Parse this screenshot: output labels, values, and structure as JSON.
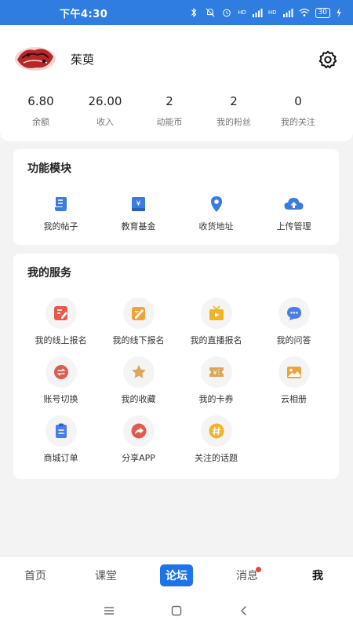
{
  "status_bar": {
    "time": "下午4:30",
    "network_labels": [
      "HD",
      "HD"
    ],
    "battery": "30"
  },
  "profile": {
    "username": "茱萸",
    "stats": [
      {
        "value": "6.80",
        "label": "余额"
      },
      {
        "value": "26.00",
        "label": "收入"
      },
      {
        "value": "2",
        "label": "动能币"
      },
      {
        "value": "2",
        "label": "我的粉丝"
      },
      {
        "value": "0",
        "label": "我的关注"
      }
    ]
  },
  "function_module": {
    "title": "功能模块",
    "items": [
      {
        "label": "我的帖子",
        "icon": "scroll-icon"
      },
      {
        "label": "教育基金",
        "icon": "book-yuan-icon"
      },
      {
        "label": "收货地址",
        "icon": "location-pin-icon"
      },
      {
        "label": "上传管理",
        "icon": "cloud-upload-icon"
      }
    ]
  },
  "my_services": {
    "title": "我的服务",
    "items": [
      {
        "label": "我的线上报名",
        "icon": "edit-doc-icon"
      },
      {
        "label": "我的线下报名",
        "icon": "pencil-pad-icon"
      },
      {
        "label": "我的直播报名",
        "icon": "tv-play-icon"
      },
      {
        "label": "我的问答",
        "icon": "chat-bubble-icon"
      },
      {
        "label": "账号切换",
        "icon": "switch-icon"
      },
      {
        "label": "我的收藏",
        "icon": "star-icon"
      },
      {
        "label": "我的卡券",
        "icon": "coupon-icon"
      },
      {
        "label": "云相册",
        "icon": "photo-album-icon"
      },
      {
        "label": "商城订单",
        "icon": "clipboard-icon"
      },
      {
        "label": "分享APP",
        "icon": "share-arrow-icon"
      },
      {
        "label": "关注的话题",
        "icon": "hashtag-icon"
      }
    ]
  },
  "tab_bar": {
    "tabs": [
      {
        "label": "首页"
      },
      {
        "label": "课堂"
      },
      {
        "label": "论坛"
      },
      {
        "label": "消息"
      },
      {
        "label": "我"
      }
    ],
    "active": "论坛"
  },
  "colors": {
    "brand_blue": "#2f7de1",
    "accent_blue": "#1e73e8",
    "badge_red": "#e84343"
  }
}
